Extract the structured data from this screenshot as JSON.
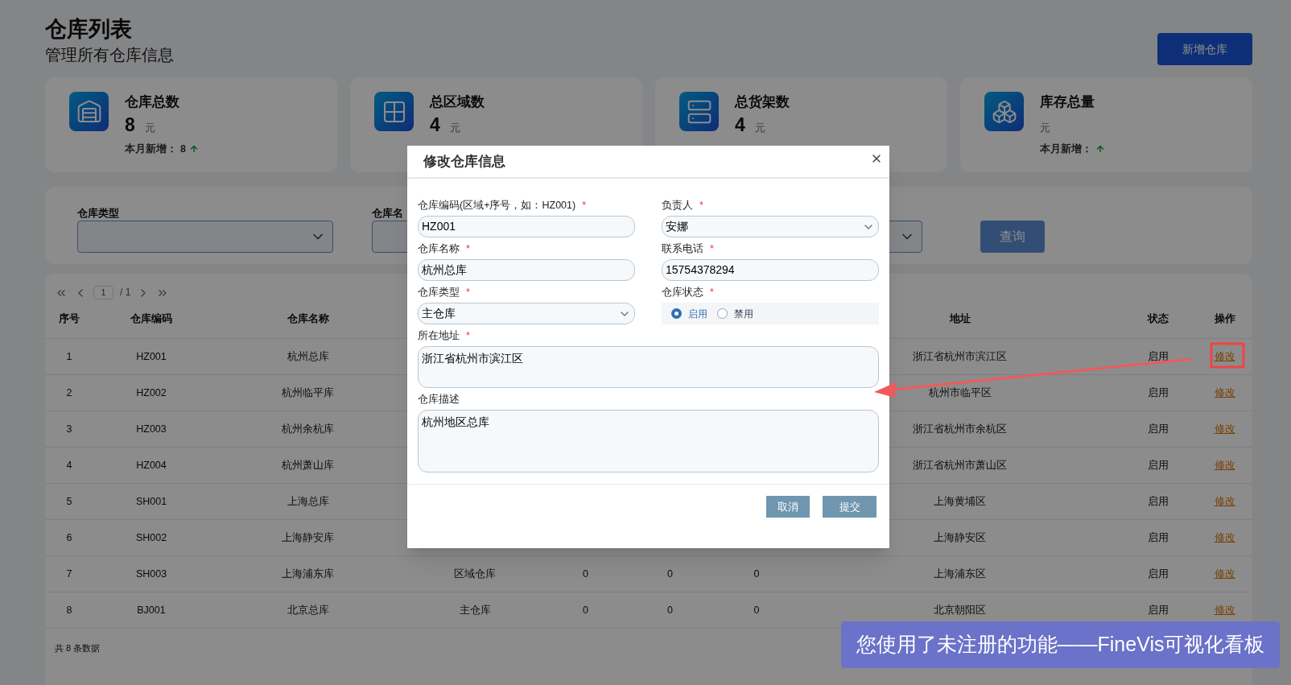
{
  "page": {
    "title": "仓库列表",
    "subtitle": "管理所有仓库信息",
    "add_button": "新增仓库"
  },
  "stats": [
    {
      "label": "仓库总数",
      "value": "8",
      "unit": "元",
      "note": "本月新增：",
      "note_value": "8"
    },
    {
      "label": "总区域数",
      "value": "4",
      "unit": "元"
    },
    {
      "label": "总货架数",
      "value": "4",
      "unit": "元"
    },
    {
      "label": "库存总量",
      "unit": "元",
      "note": "本月新增："
    }
  ],
  "filters": [
    {
      "kind": "select",
      "label": "仓库类型"
    },
    {
      "kind": "input",
      "label": "仓库名"
    },
    {
      "kind": "select"
    }
  ],
  "query_button": "查询",
  "pager": {
    "page": "1",
    "total": "/ 1"
  },
  "table": {
    "columns": [
      "序号",
      "仓库编码",
      "仓库名称"
    ],
    "tail_columns": [
      "地址",
      "状态",
      "操作"
    ],
    "rows": [
      {
        "cells": [
          "1",
          "HZ001",
          "杭州总库"
        ],
        "tail": [
          "浙江省杭州市滨江区",
          "启用"
        ],
        "action": "修改"
      },
      {
        "cells": [
          "2",
          "HZ002",
          "杭州临平库"
        ],
        "tail": [
          "杭州市临平区",
          "启用"
        ],
        "action": "修改"
      },
      {
        "cells": [
          "3",
          "HZ003",
          "杭州余杭库"
        ],
        "tail": [
          "浙江省杭州市余杭区",
          "启用"
        ],
        "action": "修改"
      },
      {
        "cells": [
          "4",
          "HZ004",
          "杭州萧山库"
        ],
        "tail": [
          "浙江省杭州市萧山区",
          "启用"
        ],
        "action": "修改"
      },
      {
        "cells": [
          "5",
          "SH001",
          "上海总库"
        ],
        "tail": [
          "上海黄埔区",
          "启用"
        ],
        "action": "修改"
      },
      {
        "cells": [
          "6",
          "SH002",
          "上海静安库"
        ],
        "tail": [
          "上海静安区",
          "启用"
        ],
        "action": "修改"
      },
      {
        "cells": [
          "7",
          "SH003",
          "上海浦东库"
        ],
        "middle": [
          "区域仓库",
          "0",
          "0",
          "0"
        ],
        "tail": [
          "上海浦东区",
          "启用"
        ],
        "action": "修改"
      },
      {
        "cells": [
          "8",
          "BJ001",
          "北京总库"
        ],
        "middle": [
          "主仓库",
          "0",
          "0",
          "0"
        ],
        "tail": [
          "北京朝阳区",
          "启用"
        ],
        "action": "修改"
      }
    ],
    "footer": "共 8 条数据"
  },
  "modal": {
    "title": "修改仓库信息",
    "fields": [
      {
        "kind": "text",
        "label": "仓库编码(区域+序号，如：HZ001)",
        "mark": "*",
        "value": "HZ001"
      },
      {
        "kind": "select",
        "label": "负责人",
        "mark": "*",
        "value": "安娜"
      },
      {
        "kind": "text",
        "label": "仓库名称",
        "mark": "*",
        "value": "杭州总库"
      },
      {
        "kind": "text",
        "label": "联系电话",
        "mark": "*",
        "value": "15754378294"
      },
      {
        "kind": "select",
        "label": "仓库类型",
        "mark": "*",
        "value": "主仓库"
      },
      {
        "kind": "radio",
        "label": "仓库状态",
        "mark": "*",
        "options": [
          {
            "label": "启用",
            "selected": true
          },
          {
            "label": "禁用",
            "selected": false
          }
        ]
      },
      {
        "kind": "textarea",
        "label": "所在地址",
        "mark": "*",
        "value": "浙江省杭州市滨江区"
      },
      {
        "kind": "memo",
        "label": "仓库描述",
        "value": "杭州地区总库"
      }
    ],
    "buttons": [
      "取消",
      "提交"
    ]
  },
  "notice": "您使用了未注册的功能——FineVis可视化看板"
}
